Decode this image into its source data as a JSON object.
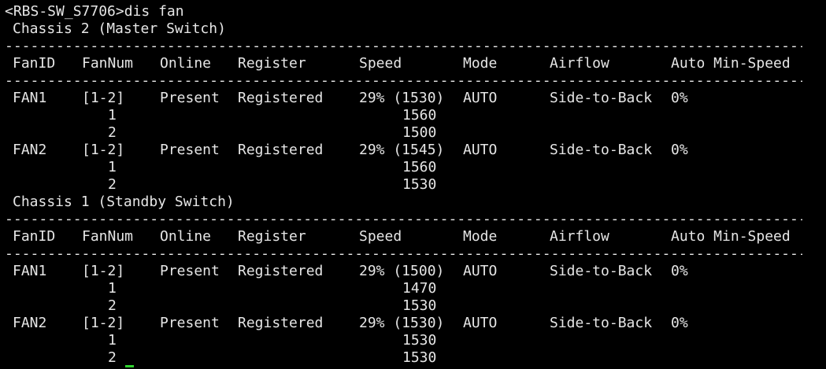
{
  "colors": {
    "background": "#000000",
    "text": "#e6e6e6",
    "cursor": "#2fd12f"
  },
  "prompt": "<RBS-SW_S7706>dis fan",
  "dashes": "--------------------------------------------------------------------------------------------------------",
  "headers": {
    "fan_id": "FanID",
    "fan_num": "FanNum",
    "online": "Online",
    "register": "Register",
    "speed": "Speed",
    "mode": "Mode",
    "airflow": "Airflow",
    "auto_min_speed": "Auto Min-Speed"
  },
  "chassis": [
    {
      "title": "Chassis 2 (Master Switch)",
      "fans": [
        {
          "id": "FAN1",
          "num": "[1-2]",
          "online": "Present",
          "register": "Registered",
          "speed": "29% (1530)",
          "mode": "AUTO",
          "airflow": "Side-to-Back",
          "min_speed": "0%",
          "subs": [
            {
              "num": "1",
              "speed": "1560"
            },
            {
              "num": "2",
              "speed": "1500"
            }
          ]
        },
        {
          "id": "FAN2",
          "num": "[1-2]",
          "online": "Present",
          "register": "Registered",
          "speed": "29% (1545)",
          "mode": "AUTO",
          "airflow": "Side-to-Back",
          "min_speed": "0%",
          "subs": [
            {
              "num": "1",
              "speed": "1560"
            },
            {
              "num": "2",
              "speed": "1530"
            }
          ]
        }
      ]
    },
    {
      "title": "Chassis 1 (Standby Switch)",
      "fans": [
        {
          "id": "FAN1",
          "num": "[1-2]",
          "online": "Present",
          "register": "Registered",
          "speed": "29% (1500)",
          "mode": "AUTO",
          "airflow": "Side-to-Back",
          "min_speed": "0%",
          "subs": [
            {
              "num": "1",
              "speed": "1470"
            },
            {
              "num": "2",
              "speed": "1530"
            }
          ]
        },
        {
          "id": "FAN2",
          "num": "[1-2]",
          "online": "Present",
          "register": "Registered",
          "speed": "29% (1530)",
          "mode": "AUTO",
          "airflow": "Side-to-Back",
          "min_speed": "0%",
          "subs": [
            {
              "num": "1",
              "speed": "1530"
            },
            {
              "num": "2",
              "speed": "1530"
            }
          ]
        }
      ]
    }
  ]
}
